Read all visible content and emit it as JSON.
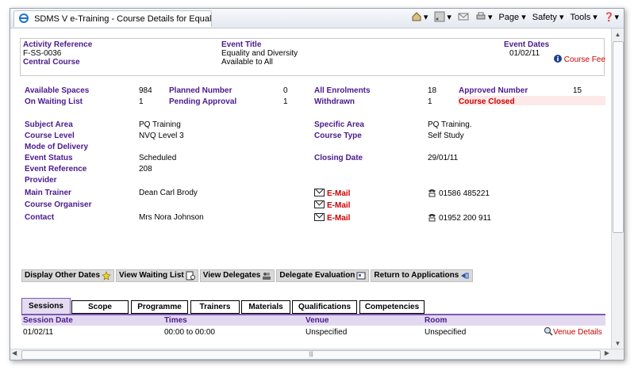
{
  "browser": {
    "tab_title": "SDMS V e-Training - Course Details for Equality a...",
    "menu_page": "Page ▾",
    "menu_safety": "Safety ▾",
    "menu_tools": "Tools ▾",
    "help": "❓▾"
  },
  "header": {
    "activity_reference_label": "Activity Reference",
    "activity_reference": "F-SS-0036",
    "central_course": "Central Course",
    "event_title_label": "Event Title",
    "event_title": "Equality and Diversity",
    "available_to": "Available to All",
    "event_dates_label": "Event Dates",
    "event_dates": "01/02/11",
    "course_fee": "Course Fee"
  },
  "stats": {
    "available_spaces_label": "Available Spaces",
    "available_spaces": "984",
    "planned_number_label": "Planned Number",
    "planned_number": "0",
    "all_enrolments_label": "All Enrolments",
    "all_enrolments": "18",
    "approved_number_label": "Approved Number",
    "approved_number": "15",
    "waiting_list_label": "On Waiting List",
    "waiting_list": "1",
    "pending_approval_label": "Pending Approval",
    "pending_approval": "1",
    "withdrawn_label": "Withdrawn",
    "withdrawn": "1",
    "course_closed": "Course Closed"
  },
  "details": {
    "subject_area_label": "Subject Area",
    "subject_area": "PQ Training",
    "specific_area_label": "Specific Area",
    "specific_area": "PQ Training.",
    "course_level_label": "Course Level",
    "course_level": "NVQ Level 3",
    "course_type_label": "Course Type",
    "course_type": "Self Study",
    "mode_label": "Mode of Delivery",
    "event_status_label": "Event Status",
    "event_status": "Scheduled",
    "closing_date_label": "Closing Date",
    "closing_date": "29/01/11",
    "event_reference_label": "Event Reference",
    "event_reference": "208",
    "provider_label": "Provider",
    "main_trainer_label": "Main Trainer",
    "main_trainer": "Dean Carl Brody",
    "main_trainer_email": "E-Mail",
    "main_trainer_phone": "01586 485221",
    "organiser_label": "Course Organiser",
    "organiser_email": "E-Mail",
    "contact_label": "Contact",
    "contact": "Mrs Nora Johnson",
    "contact_email": "E-Mail",
    "contact_phone": "01952 200 911"
  },
  "actions": {
    "display_other_dates": "Display Other Dates",
    "view_waiting_list": "View Waiting List",
    "view_delegates": "View Delegates",
    "delegate_evaluation": "Delegate Evaluation",
    "return_to_applications": "Return to Applications"
  },
  "tabs": [
    "Sessions",
    "Scope",
    "Programme",
    "Trainers",
    "Materials",
    "Qualifications",
    "Competencies"
  ],
  "sessions": {
    "headers": [
      "Session Date",
      "Times",
      "Venue",
      "Room"
    ],
    "row": {
      "date": "01/02/11",
      "times": "00:00 to 00:00",
      "venue": "Unspecified",
      "room": "Unspecified",
      "venue_details": "Venue Details"
    }
  },
  "colors": {
    "label": "#4b1a8c",
    "alert": "#cc0000",
    "tab_accent": "#7d58b0"
  }
}
